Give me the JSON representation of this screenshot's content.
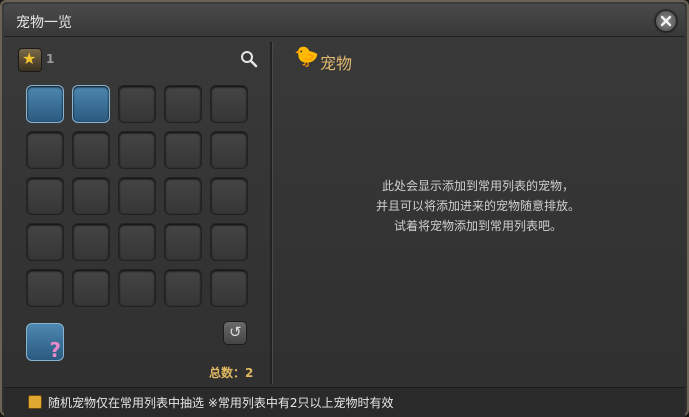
{
  "window": {
    "title": "宠物一览"
  },
  "left_panel": {
    "favorite_count": "1",
    "total_label": "总数：2",
    "grid": {
      "rows": 5,
      "cols": 5,
      "filled": 2
    }
  },
  "right_panel": {
    "title": "宠物",
    "message_lines": [
      "此处会显示添加到常用列表的宠物，",
      "并且可以将添加进来的宠物随意排放。",
      "试着将宠物添加到常用列表吧。"
    ]
  },
  "footer": {
    "checkbox_label": "随机宠物仅在常用列表中抽选 ※常用列表中有2只以上宠物时有效"
  },
  "icons": {
    "close": "close-icon",
    "search": "search-icon",
    "favorite": "star-icon",
    "random": "question-mark-icon",
    "sort": "sort-icon",
    "minion": "chocobo-icon"
  },
  "colors": {
    "accent": "#e0b870",
    "slot_filled": "#3a6e96",
    "checkbox": "#e0a830"
  }
}
